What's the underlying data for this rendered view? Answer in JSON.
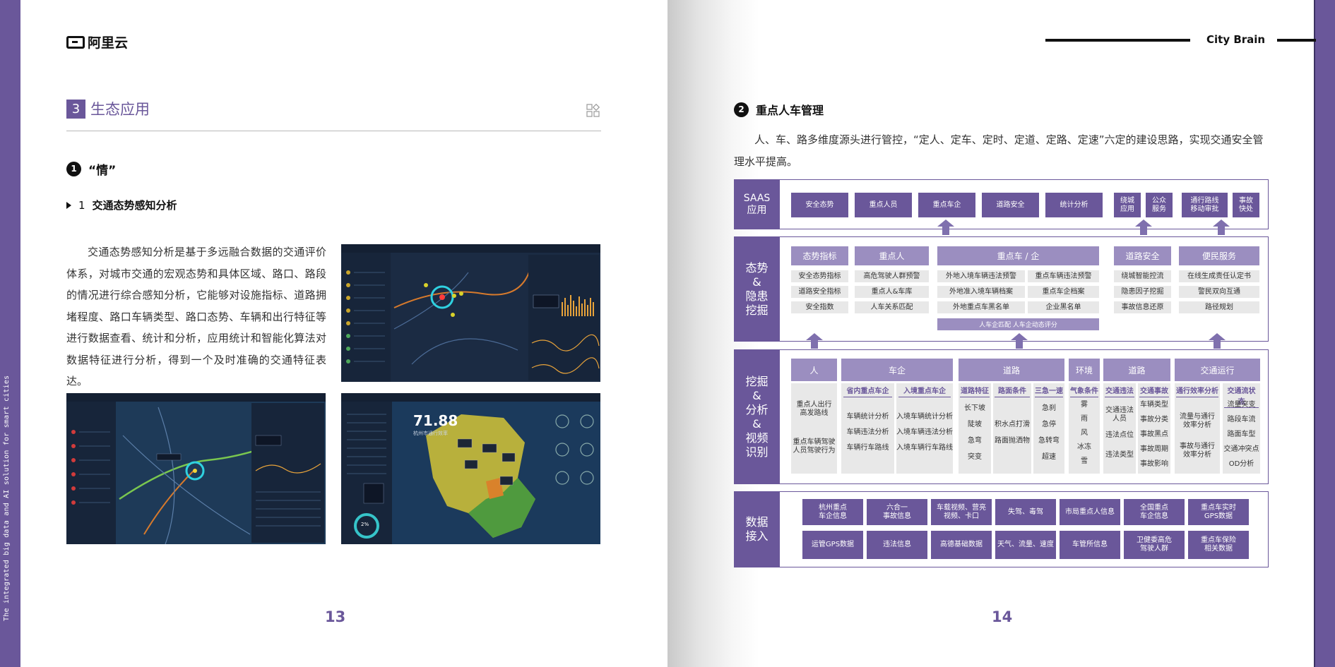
{
  "left_page": {
    "logo_text": "阿里云",
    "vertical_caption": "The integrated big data and AI solution for smart cities",
    "section_number": "3",
    "section_title": "生态应用",
    "item_number": "1",
    "item_title": "“情”",
    "sub_number": "1",
    "sub_title": "交通态势感知分析",
    "paragraph": "交通态势感知分析是基于多远融合数据的交通评价体系，对城市交通的宏观态势和具体区域、路口、路段的情况进行综合感知分析，它能够对设施指标、道路拥堵程度、路口车辆类型、路口态势、车辆和出行特征等进行数据查看、统计和分析，应用统计和智能化算法对数据特征进行分析，得到一个及时准确的交通特征表达。",
    "screenshot3_value": "71.88",
    "screenshot3_caption": "杭州市通行效率",
    "screenshot3_gauge": "2%",
    "page_number": "13"
  },
  "right_page": {
    "header_text": "City Brain",
    "item_number": "2",
    "item_title": "重点人车管理",
    "intro": "人、车、路多维度源头进行管控，“定人、定车、定时、定道、定路、定速”六定的建设思路，实现交通安全管理水平提高。",
    "page_number": "14",
    "diagram": {
      "saas": {
        "label": "SAAS\n应用",
        "buttons": [
          "安全态势",
          "重点人员",
          "重点车企",
          "道路安全",
          "统计分析"
        ],
        "small_buttons": [
          "绕城\n应用",
          "公众\n服务",
          "通行路线\n移动审批",
          "事故\n快处"
        ]
      },
      "situation": {
        "label": "态势\n&\n隐患\n挖掘",
        "groups": [
          {
            "title": "态势指标",
            "items": [
              "安全态势指标",
              "道路安全指标",
              "安全指数"
            ]
          },
          {
            "title": "重点人",
            "items": [
              "高危驾驶人群预警",
              "重点人&车库",
              "人车关系匹配"
            ]
          },
          {
            "title": "重点车 / 企",
            "items": [
              "外地入境车辆违法预警",
              "重点车辆违法预警",
              "外地准入境车辆档案",
              "重点车企档案",
              "外地重点车黑名单",
              "企业黑名单"
            ],
            "footer": "人车企匹配  人车企动态评分"
          },
          {
            "title": "道路安全",
            "items": [
              "绕城智能控流",
              "隐患因子挖掘",
              "事故信息还原"
            ]
          },
          {
            "title": "便民服务",
            "items": [
              "在线生成责任认定书",
              "警民双向互通",
              "路径规划"
            ]
          }
        ]
      },
      "mining": {
        "label": "挖掘\n&\n分析\n&\n视频\n识别",
        "person": {
          "title": "人",
          "items": [
            "重点人出行\n高发路线",
            "重点车辆驾驶\n人员驾驶行为"
          ]
        },
        "vehicle": {
          "title": "车企",
          "cols": [
            {
              "head": "省内重点车企",
              "items": [
                "车辆统计分析",
                "车辆违法分析",
                "车辆行车路线"
              ]
            },
            {
              "head": "入境重点车企",
              "items": [
                "入境车辆统计分析",
                "入境车辆违法分析",
                "入境车辆行车路线"
              ]
            }
          ]
        },
        "road": {
          "title": "道路",
          "cols": [
            {
              "head": "道路特征",
              "items": [
                "长下坡",
                "陡坡",
                "急弯",
                "突变"
              ]
            },
            {
              "head": "路面条件",
              "items": [
                "积水点打滑",
                "路面抛洒物"
              ]
            },
            {
              "head": "三急一速",
              "items": [
                "急刹",
                "急停",
                "急转弯",
                "超速"
              ]
            }
          ]
        },
        "env": {
          "title": "环境",
          "cols": [
            {
              "head": "气象条件",
              "items": [
                "雾",
                "雨",
                "风",
                "冰冻",
                "雪"
              ]
            }
          ]
        },
        "road2": {
          "title": "道路",
          "cols": [
            {
              "head": "交通违法",
              "items": [
                "交通违法\n人员",
                "违法点位",
                "违法类型"
              ]
            },
            {
              "head": "交通事故",
              "items": [
                "车辆类型",
                "事故分类",
                "事故黑点",
                "事故周期",
                "事故影响"
              ]
            }
          ]
        },
        "traffic": {
          "title": "交通运行",
          "cols": [
            {
              "head": "通行效率分析",
              "items": [
                "流量与通行\n效率分析",
                "事故与通行\n效率分析"
              ]
            },
            {
              "head": "交通流状态",
              "items": [
                "流量突变",
                "路段车流",
                "路面车型",
                "交通冲突点",
                "OD分析"
              ]
            }
          ]
        }
      },
      "data": {
        "label": "数据\n接入",
        "row1": [
          "杭州重点\n车企信息",
          "六合一\n事故信息",
          "车载视频、营亮\n视频、卡口",
          "失驾、毒驾",
          "市局重点人信息",
          "全国重点\n车企信息",
          "重点车实时\nGPS数据"
        ],
        "row2": [
          "运管GPS数据",
          "违法信息",
          "高德基础数据",
          "天气、流量、速度",
          "车管所信息",
          "卫健委高危\n驾驶人群",
          "重点车保险\n相关数据"
        ]
      }
    }
  },
  "colors": {
    "brand_purple": "#6a579a",
    "light_purple": "#9b8ec0",
    "cell_gray": "#e8e8e8",
    "dashboard_bg": "#1b2b43",
    "map_yellow": "#b8b03c",
    "map_green": "#4f9a3e",
    "gauge_teal": "#36c4c9"
  }
}
